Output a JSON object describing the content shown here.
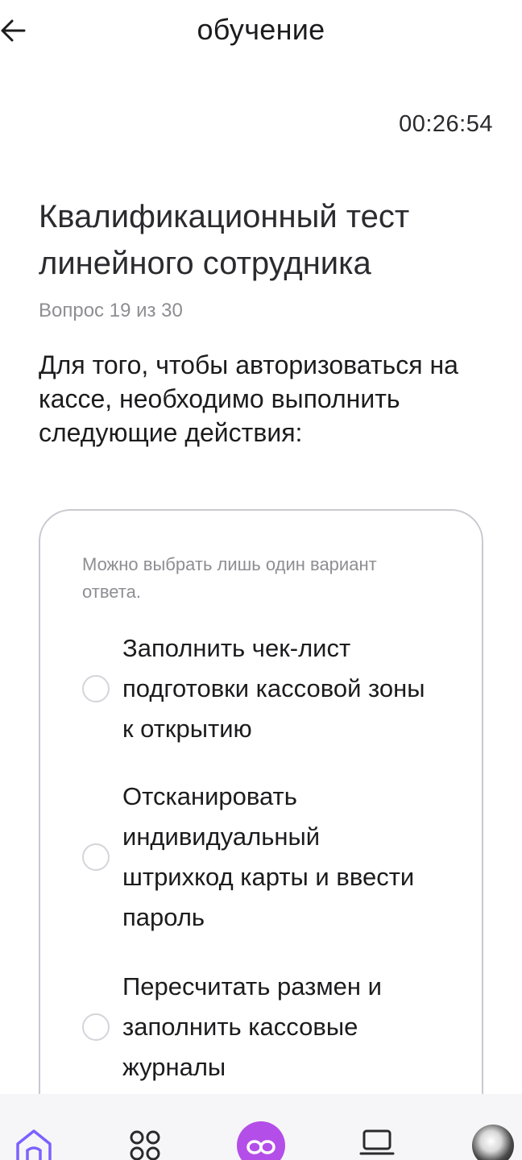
{
  "header": {
    "title": "обучение",
    "back_icon": "arrow-left-icon"
  },
  "timer": "00:26:54",
  "test": {
    "title_line1": "Квалификационный тест",
    "title_line2": "линейного сотрудника",
    "progress": "Вопрос 19 из 30",
    "question": "Для того, чтобы авторизоваться на кассе, необходимо выполнить следующие действия:"
  },
  "answers": {
    "hint": "Можно выбрать лишь один вариант ответа.",
    "options": [
      {
        "label": "Заполнить чек-лист подготовки кассовой зоны к открытию",
        "selected": false
      },
      {
        "label": "Отсканировать индивидуальный штрихкод карты и ввести пароль",
        "selected": false
      },
      {
        "label": "Пересчитать размен и заполнить кассовые журналы",
        "selected": false
      }
    ]
  },
  "tabbar": {
    "items": [
      {
        "icon": "home-icon",
        "active": true
      },
      {
        "icon": "grid-icon",
        "active": false
      },
      {
        "icon": "infinity-icon",
        "active": false
      },
      {
        "icon": "laptop-icon",
        "active": false
      },
      {
        "icon": "avatar",
        "active": false
      }
    ],
    "accent_color": "#7b61ff",
    "center_color": "#b44ee8"
  }
}
